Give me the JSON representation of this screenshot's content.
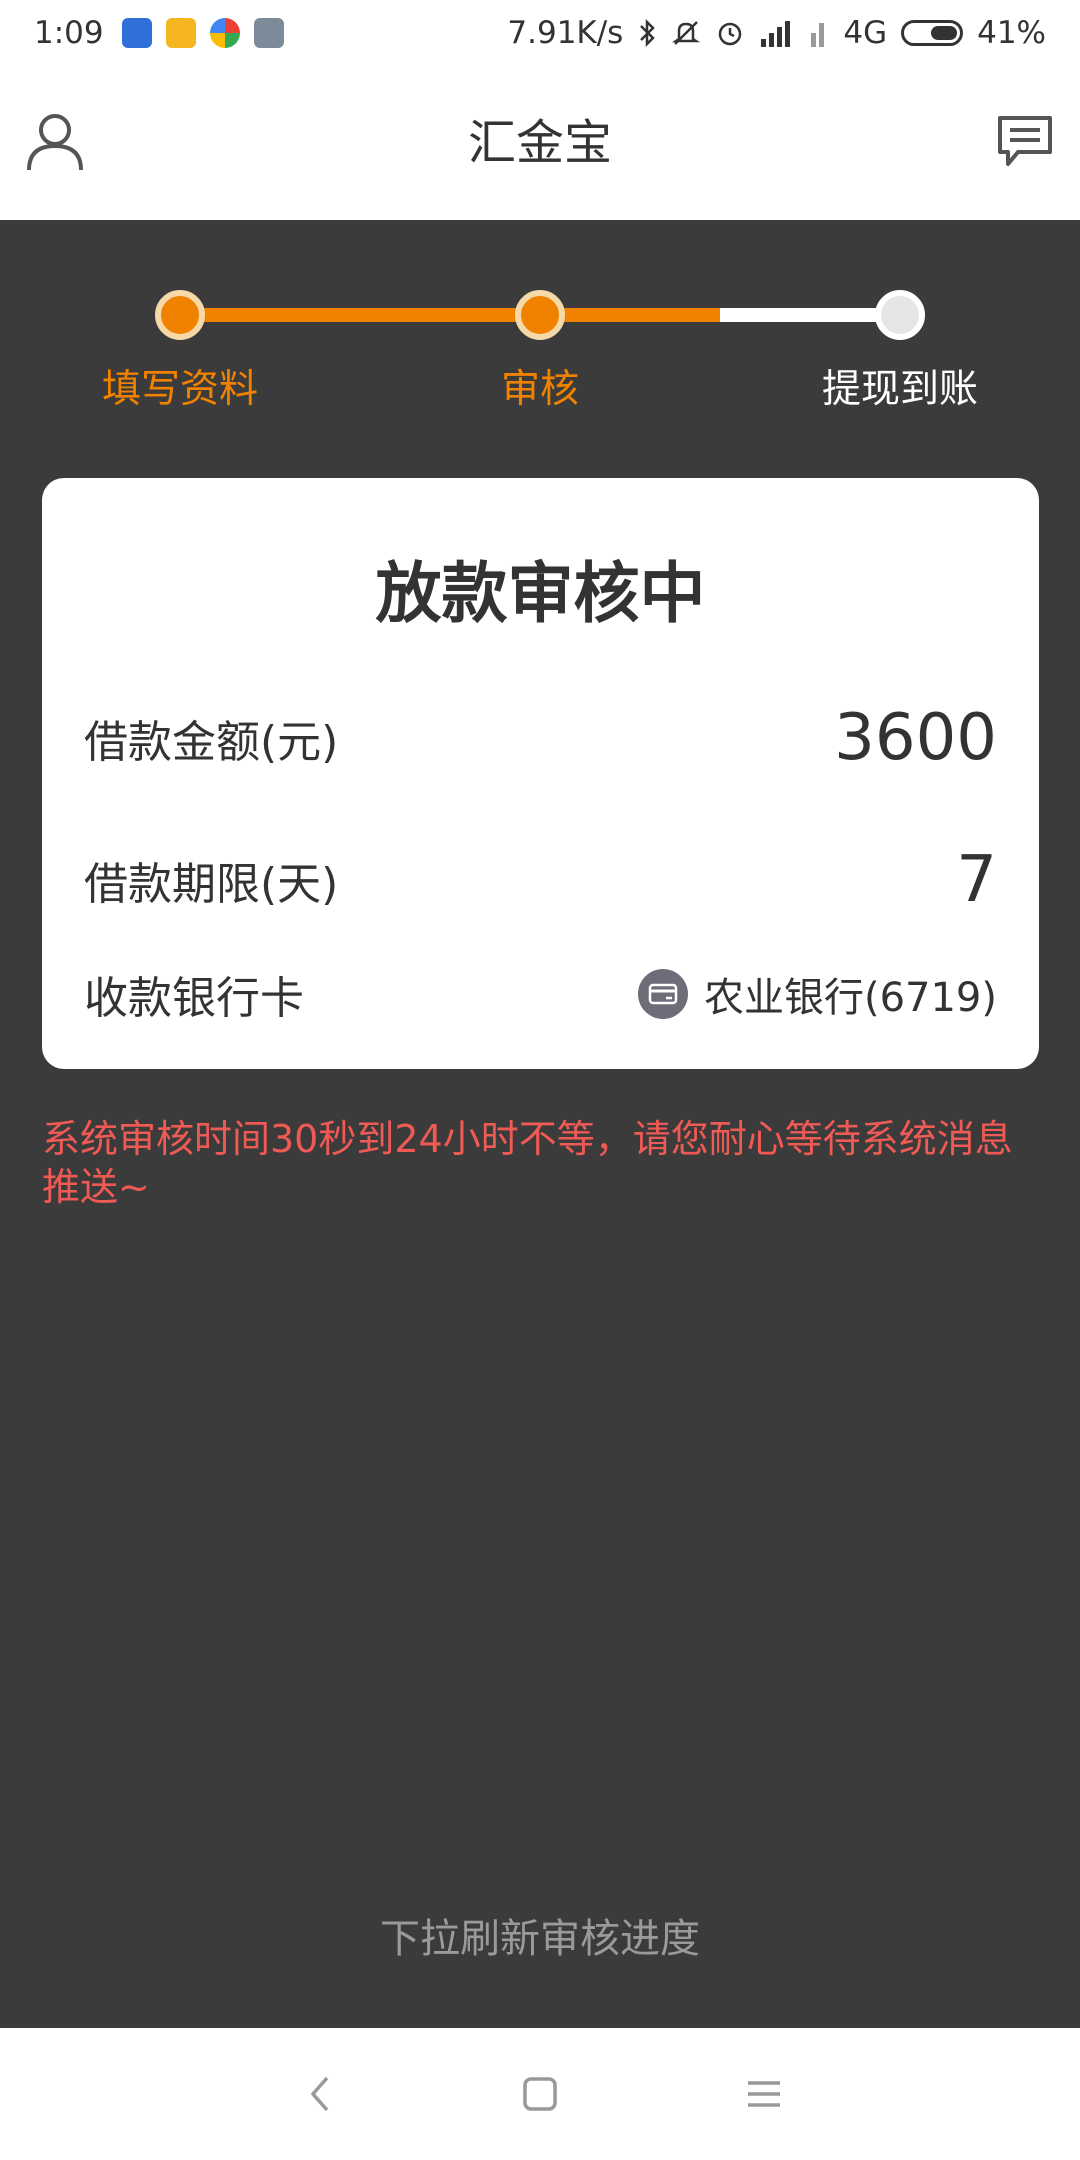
{
  "status_bar": {
    "time": "1:09",
    "network_speed": "7.91K/s",
    "signal_type": "4G",
    "battery_percent": "41%",
    "battery_level": 0.41,
    "icons": [
      "shield-app-icon",
      "chat-app-icon",
      "browser-app-icon",
      "calculator-app-icon",
      "bluetooth-icon",
      "mute-icon",
      "alarm-icon",
      "hd-signal-icon",
      "signal-icon",
      "battery-icon"
    ]
  },
  "header": {
    "title": "汇金宝",
    "left_icon": "user-icon",
    "right_icon": "message-icon"
  },
  "progress": {
    "steps": [
      {
        "label": "填写资料",
        "state": "done"
      },
      {
        "label": "审核",
        "state": "done"
      },
      {
        "label": "提现到账",
        "state": "todo"
      }
    ],
    "active_color": "#f08200",
    "inactive_color": "#ffffff"
  },
  "card": {
    "title": "放款审核中",
    "amount_label": "借款金额(元)",
    "amount_value": "3600",
    "term_label": "借款期限(天)",
    "term_value": "7",
    "bank_label": "收款银行卡",
    "bank_value": "农业银行(6719)",
    "bank_icon": "bank-card-icon"
  },
  "notice": {
    "text": "系统审核时间30秒到24小时不等，请您耐心等待系统消息推送~",
    "color": "#f05a55"
  },
  "pull_refresh": {
    "text": "下拉刷新审核进度"
  },
  "nav_bar": {
    "icons": [
      "back-icon",
      "home-icon",
      "menu-icon"
    ]
  }
}
